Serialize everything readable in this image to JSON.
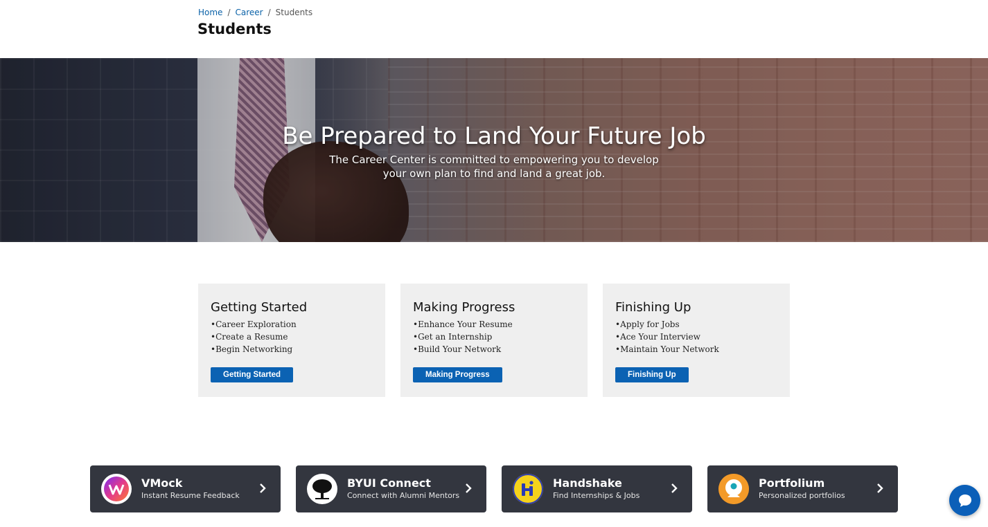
{
  "breadcrumb": {
    "items": [
      "Home",
      "Career",
      "Students"
    ],
    "separator": "/"
  },
  "page": {
    "title": "Students"
  },
  "hero": {
    "title": "Be Prepared to Land Your Future Job",
    "subtitle_line1": "The Career Center is committed to empowering you to develop",
    "subtitle_line2": "your own plan to find and land a great job."
  },
  "cards": [
    {
      "title": "Getting Started",
      "items": [
        "Career Exploration",
        "Create a Resume",
        "Begin Networking"
      ],
      "button": "Getting Started"
    },
    {
      "title": "Making Progress",
      "items": [
        "Enhance Your Resume",
        "Get an Internship",
        "Build Your Network"
      ],
      "button": "Making Progress"
    },
    {
      "title": "Finishing Up",
      "items": [
        "Apply for Jobs",
        "Ace Your Interview",
        "Maintain Your Network"
      ],
      "button": "Finishing Up"
    }
  ],
  "links": [
    {
      "name": "VMock",
      "desc": "Instant Resume Feedback",
      "icon": "vmock-logo-icon"
    },
    {
      "name": "BYUI Connect",
      "desc": "Connect with Alumni Mentors",
      "icon": "tree-logo-icon"
    },
    {
      "name": "Handshake",
      "desc": "Find Internships & Jobs",
      "icon": "handshake-logo-icon"
    },
    {
      "name": "Portfolium",
      "desc": "Personalized portfolios",
      "icon": "portfolium-logo-icon"
    }
  ],
  "colors": {
    "accent": "#0b62b3",
    "link": "#0b62a8",
    "dark_card": "#33363f",
    "card_bg": "#efefef"
  },
  "chat": {
    "icon": "chat-bubble-icon"
  }
}
